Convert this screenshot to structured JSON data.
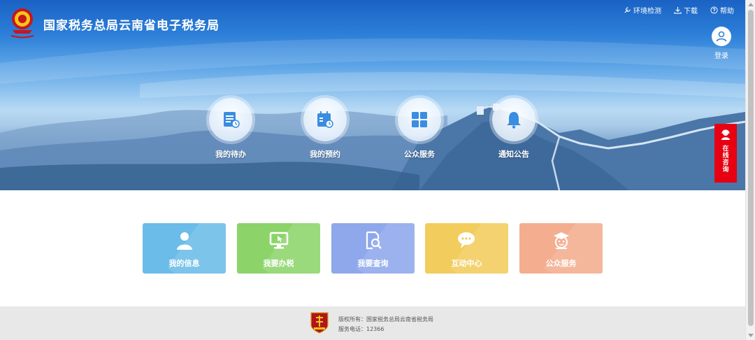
{
  "header": {
    "title": "国家税务总局云南省电子税务局",
    "links": [
      {
        "label": "环境检测",
        "icon": "wrench-icon"
      },
      {
        "label": "下载",
        "icon": "download-icon"
      },
      {
        "label": "帮助",
        "icon": "help-icon"
      }
    ],
    "login_label": "登录"
  },
  "hero_items": [
    {
      "label": "我的待办",
      "icon": "todo-icon"
    },
    {
      "label": "我的预约",
      "icon": "calendar-icon"
    },
    {
      "label": "公众服务",
      "icon": "grid-icon"
    },
    {
      "label": "通知公告",
      "icon": "bell-icon"
    }
  ],
  "consult": {
    "chars": [
      "在",
      "线",
      "咨",
      "询"
    ],
    "color": "#e60012"
  },
  "cards": [
    {
      "label": "我的信息",
      "icon": "user-icon",
      "color": "#6bbce8"
    },
    {
      "label": "我要办税",
      "icon": "monitor-icon",
      "color": "#8cd46a"
    },
    {
      "label": "我要查询",
      "icon": "search-doc-icon",
      "color": "#8fa8ec"
    },
    {
      "label": "互动中心",
      "icon": "chat-icon",
      "color": "#f2cc5c"
    },
    {
      "label": "公众服务",
      "icon": "mascot-icon",
      "color": "#f4ae8f"
    }
  ],
  "footer": {
    "copyright": "版权所有：国家税务总局云南省税务局",
    "phone": "服务电话：12366"
  },
  "colors": {
    "brand_blue": "#1a62c4",
    "footer_bg": "#e8e8e8"
  }
}
